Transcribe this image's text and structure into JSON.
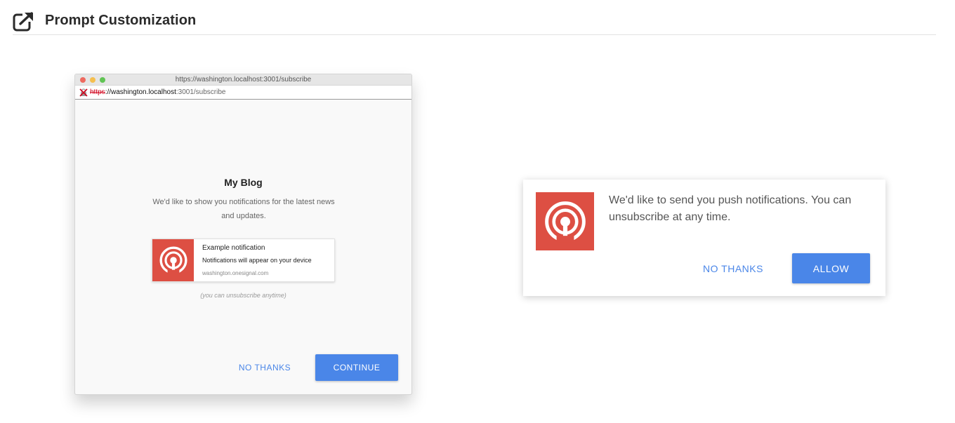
{
  "header": {
    "title": "Prompt Customization",
    "icon": "external-link-icon"
  },
  "browser": {
    "titlebar_url": "https://washington.localhost:3001/subscribe",
    "address": {
      "scheme": "https",
      "host": "://washington.localhost",
      "rest": ":3001/subscribe"
    },
    "blog_title": "My Blog",
    "message": "We'd like to show you notifications for the latest news and updates.",
    "example_notification": {
      "title": "Example notification",
      "body": "Notifications will appear on your device",
      "domain": "washington.onesignal.com",
      "icon": "onesignal-icon"
    },
    "unsubscribe_note": "(you can unsubscribe anytime)",
    "buttons": {
      "no_thanks": "No Thanks",
      "continue": "Continue"
    }
  },
  "native_prompt": {
    "message": "We'd like to send you push notifications. You can unsubscribe at any time.",
    "icon": "onesignal-icon",
    "buttons": {
      "no_thanks": "No Thanks",
      "allow": "Allow"
    }
  },
  "colors": {
    "accent_blue": "#4a86e8",
    "brand_red": "#dd4f43",
    "title_text": "#2b2b2b"
  }
}
